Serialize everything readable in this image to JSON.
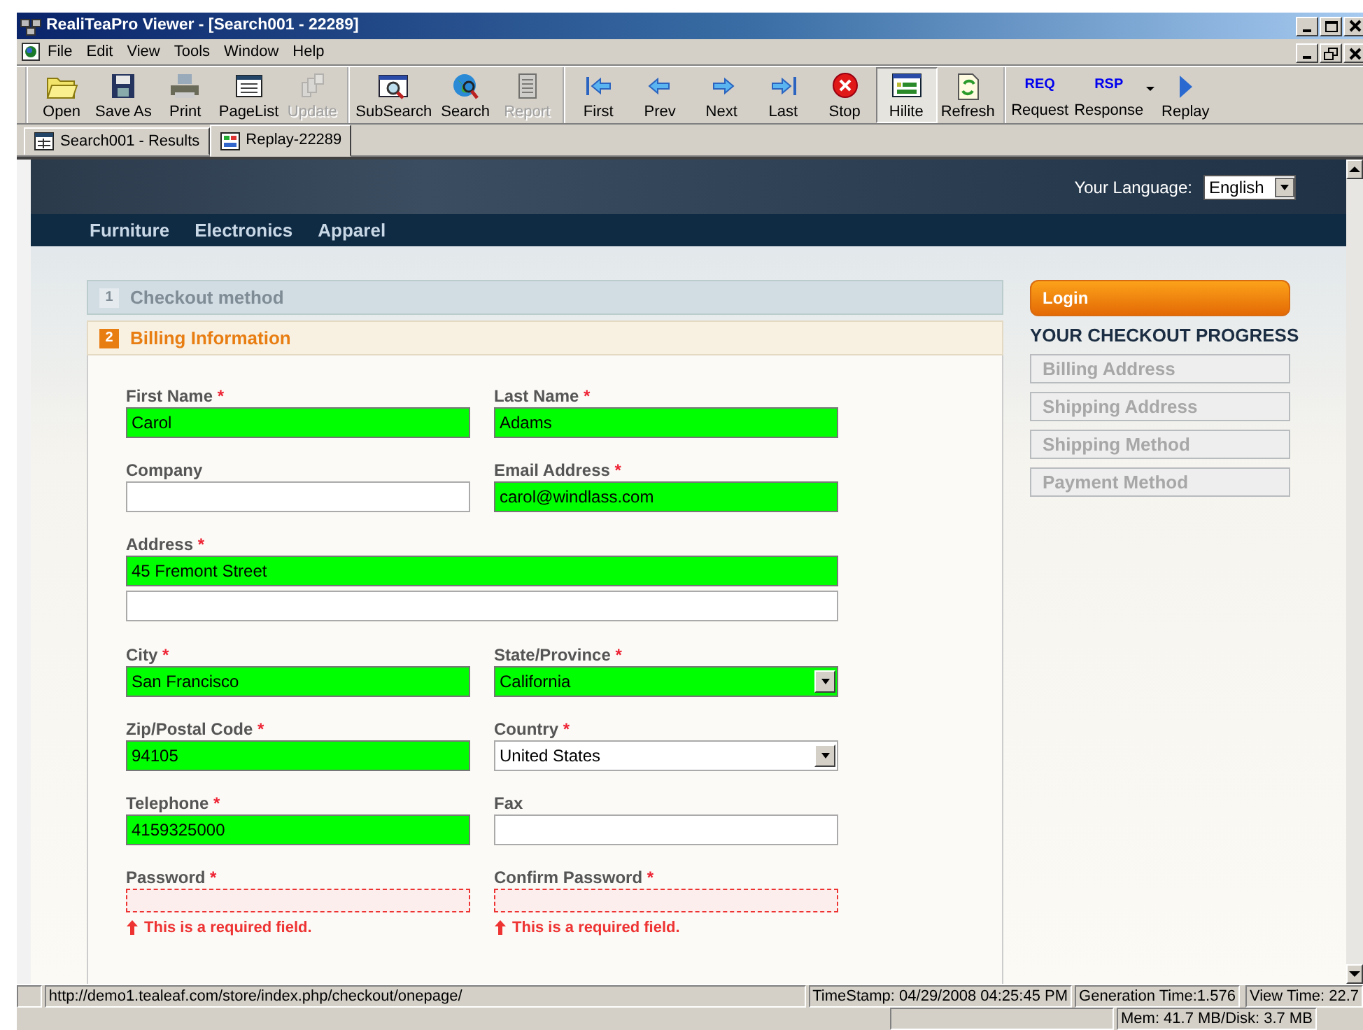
{
  "window": {
    "title": "RealiTeaPro Viewer - [Search001 - 22289]"
  },
  "menu": [
    "File",
    "Edit",
    "View",
    "Tools",
    "Window",
    "Help"
  ],
  "toolbar": [
    [
      {
        "label": "Open",
        "disabled": false,
        "selected": false
      },
      {
        "label": "Save As",
        "disabled": false,
        "selected": false
      },
      {
        "label": "Print",
        "disabled": false,
        "selected": false
      },
      {
        "label": "PageList",
        "disabled": false,
        "selected": false
      },
      {
        "label": "Update",
        "disabled": true,
        "selected": false
      }
    ],
    [
      {
        "label": "SubSearch",
        "disabled": false,
        "selected": false
      },
      {
        "label": "Search",
        "disabled": false,
        "selected": false
      },
      {
        "label": "Report",
        "disabled": true,
        "selected": false
      }
    ],
    [
      {
        "label": "First",
        "disabled": false,
        "selected": false
      },
      {
        "label": "Prev",
        "disabled": false,
        "selected": false
      },
      {
        "label": "Next",
        "disabled": false,
        "selected": false
      },
      {
        "label": "Last",
        "disabled": false,
        "selected": false
      },
      {
        "label": "Stop",
        "disabled": false,
        "selected": false
      },
      {
        "label": "Hilite",
        "disabled": false,
        "selected": true
      },
      {
        "label": "Refresh",
        "disabled": false,
        "selected": false
      }
    ],
    [
      {
        "label": "Request",
        "disabled": false,
        "selected": false,
        "icon_text": "REQ"
      },
      {
        "label": "Response",
        "disabled": false,
        "selected": false,
        "icon_text": "RSP",
        "dropdown": true
      },
      {
        "label": "Replay",
        "disabled": false,
        "selected": false
      }
    ]
  ],
  "tabs": [
    {
      "label": "Search001 - Results",
      "selected": false
    },
    {
      "label": "Replay-22289",
      "selected": true
    }
  ],
  "page": {
    "language": {
      "label": "Your Language:",
      "value": "English"
    },
    "nav": [
      "Furniture",
      "Electronics",
      "Apparel"
    ],
    "steps": [
      {
        "number": "1",
        "title": "Checkout method",
        "selected": false
      },
      {
        "number": "2",
        "title": "Billing Information",
        "selected": true
      }
    ],
    "form_rows": [
      [
        {
          "kind": "text",
          "label": "First Name",
          "required": true,
          "value": "Carol",
          "highlighted": true,
          "invalid": false
        },
        {
          "kind": "text",
          "label": "Last Name",
          "required": true,
          "value": "Adams",
          "highlighted": true,
          "invalid": false
        }
      ],
      [
        {
          "kind": "text",
          "label": "Company",
          "required": false,
          "highlighted": false,
          "invalid": false
        },
        {
          "kind": "text",
          "label": "Email Address",
          "required": true,
          "value": "carol@windlass.com",
          "highlighted": true,
          "invalid": false
        }
      ],
      [
        {
          "kind": "wide",
          "label": "Address",
          "required": true,
          "value": "45 Fremont Street",
          "highlighted": true,
          "invalid": false
        }
      ],
      [
        {
          "kind": "wide",
          "highlighted": false,
          "invalid": false
        }
      ],
      [
        {
          "kind": "text",
          "label": "City",
          "required": true,
          "value": "San Francisco",
          "highlighted": true,
          "invalid": false
        },
        {
          "kind": "select",
          "label": "State/Province",
          "required": true,
          "value": "California",
          "highlighted": true,
          "invalid": false
        }
      ],
      [
        {
          "kind": "text",
          "label": "Zip/Postal Code",
          "required": true,
          "value": "94105",
          "highlighted": true,
          "invalid": false
        },
        {
          "kind": "select",
          "label": "Country",
          "required": true,
          "value": "United States",
          "highlighted": false,
          "invalid": false
        }
      ],
      [
        {
          "kind": "text",
          "label": "Telephone",
          "required": true,
          "value": "4159325000",
          "highlighted": true,
          "invalid": false
        },
        {
          "kind": "text",
          "label": "Fax",
          "required": false,
          "highlighted": false,
          "invalid": false
        }
      ],
      [
        {
          "kind": "text",
          "label": "Password",
          "required": true,
          "highlighted": false,
          "invalid": true,
          "error": "This is a required field."
        },
        {
          "kind": "text",
          "label": "Confirm Password",
          "required": true,
          "highlighted": false,
          "invalid": true,
          "error": "This is a required field."
        }
      ]
    ],
    "required_mark": "*",
    "login_button": "Login",
    "progress_title": "YOUR CHECKOUT PROGRESS",
    "progress": [
      "Billing Address",
      "Shipping Address",
      "Shipping Method",
      "Payment Method"
    ]
  },
  "status_bar": {
    "url": "http://demo1.tealeaf.com/store/index.php/checkout/onepage/",
    "timestamp": "TimeStamp: 04/29/2008 04:25:45 PM",
    "generation_time": "Generation Time:1.576",
    "view_time": "View Time: 22.7",
    "memory": "Mem: 41.7 MB/Disk: 3.7 MB"
  }
}
